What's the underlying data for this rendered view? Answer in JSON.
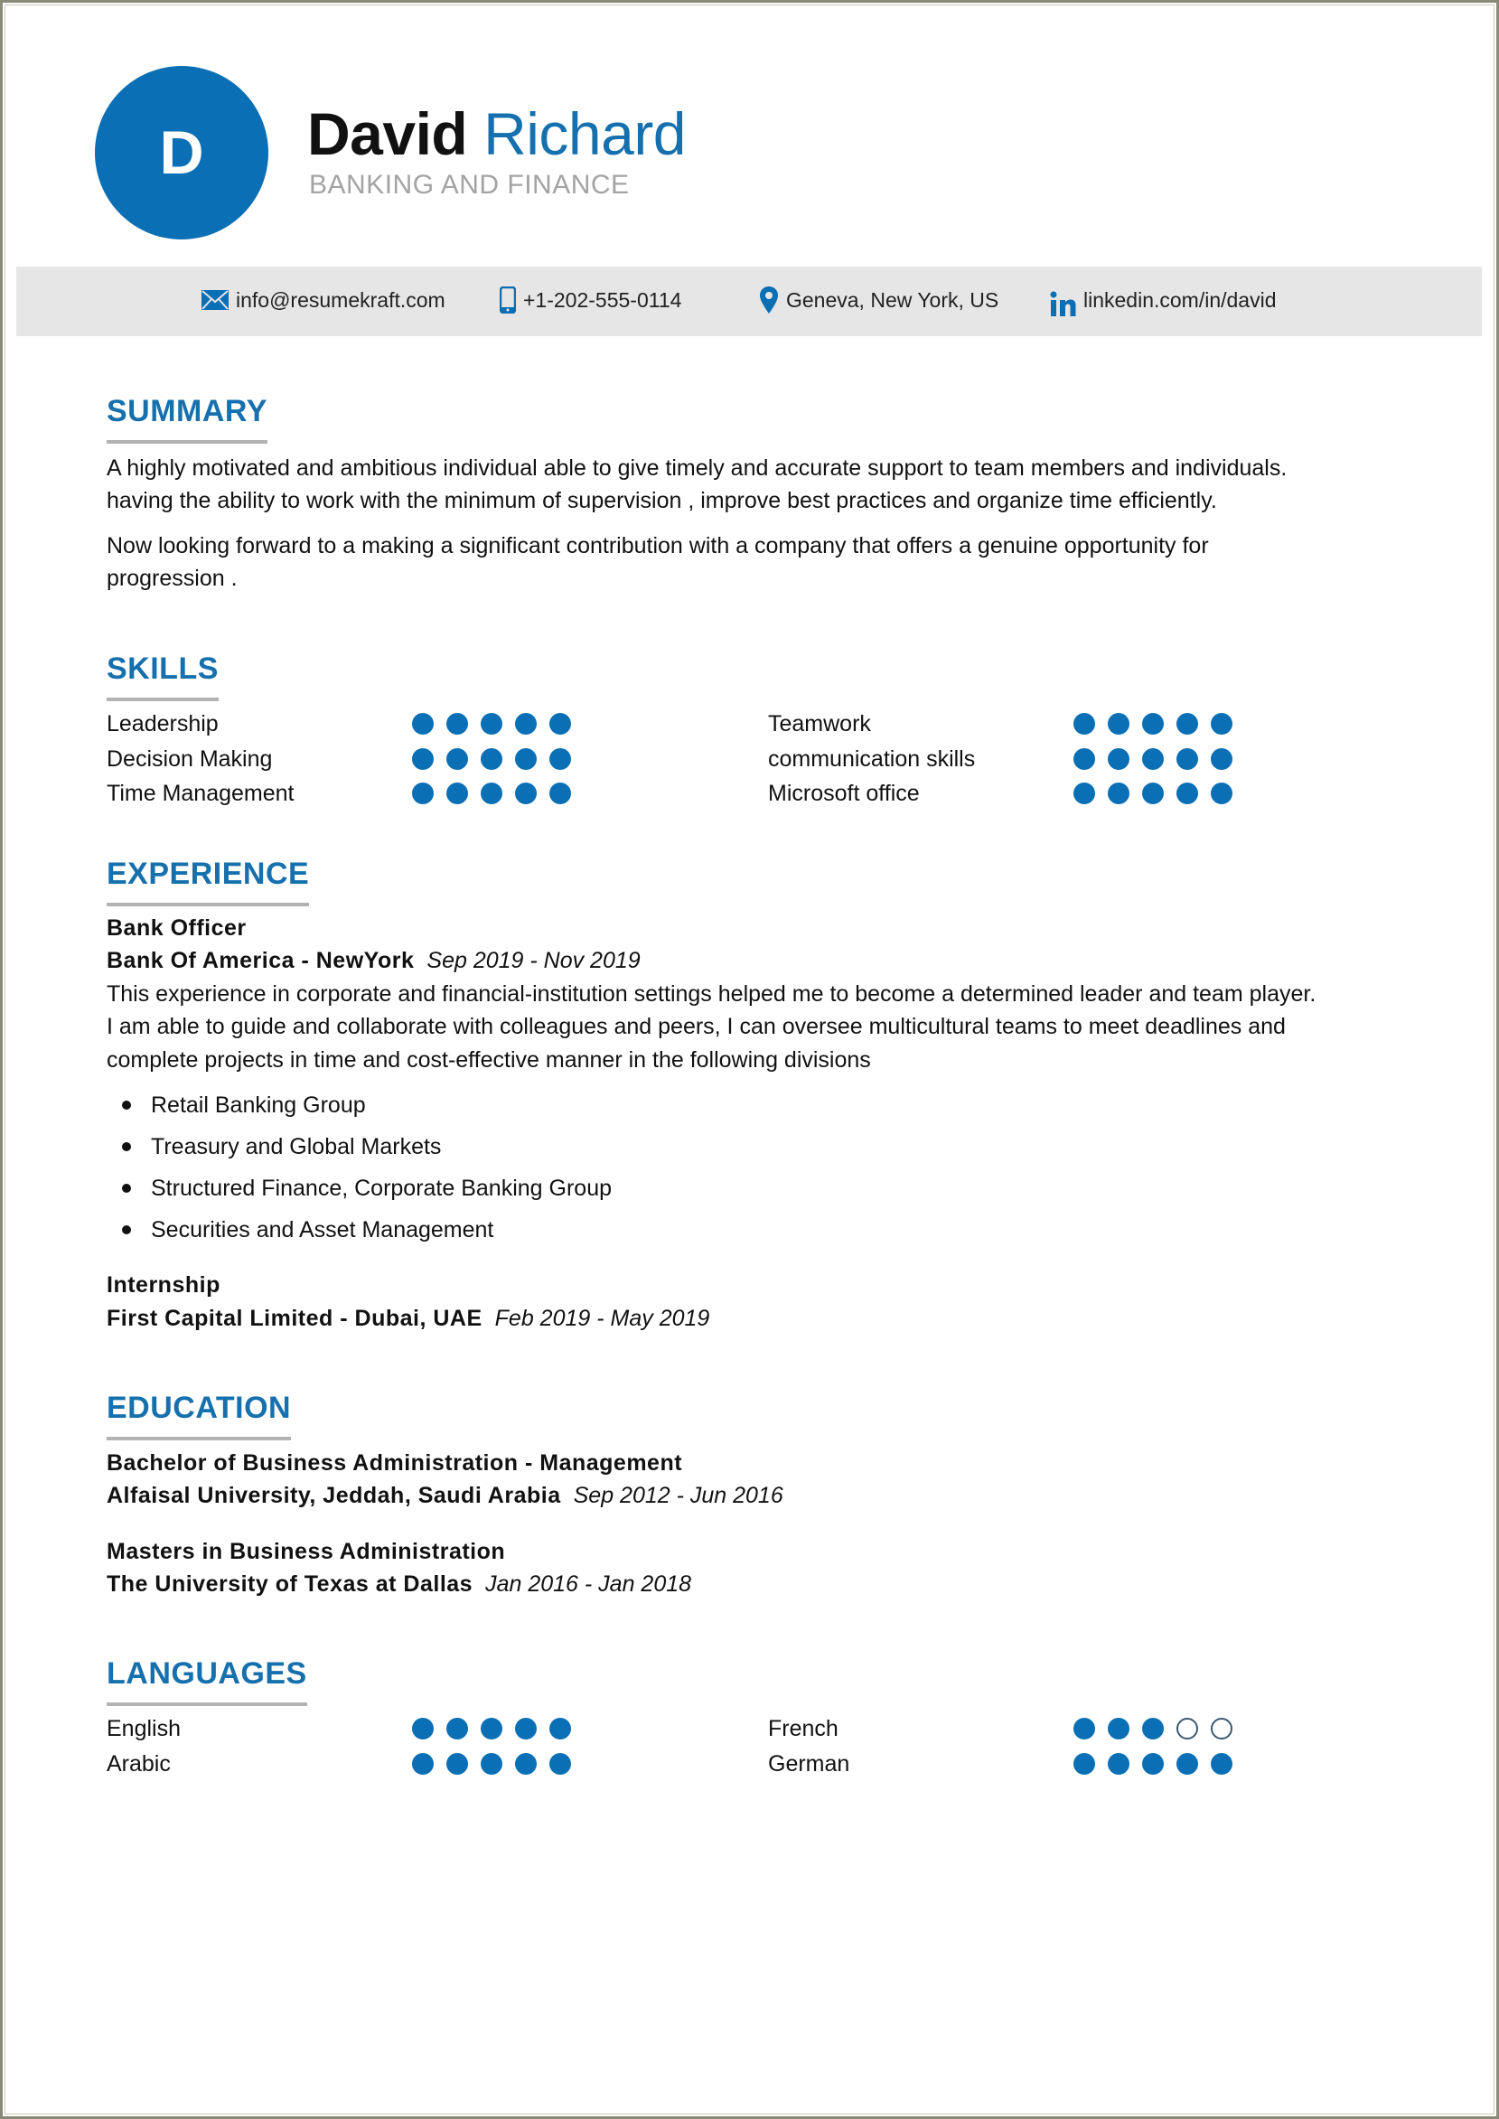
{
  "header": {
    "avatar_initial": "D",
    "first_name": "David",
    "last_name": "Richard",
    "title": "BANKING AND FINANCE"
  },
  "contact": {
    "email": "info@resumekraft.com",
    "phone": "+1-202-555-0114",
    "location": "Geneva, New York, US",
    "linkedin": "linkedin.com/in/david"
  },
  "colors": {
    "accent": "#1570ad",
    "dot_fill": "#0a6fb5",
    "underline": "#b3b3b3",
    "contact_bar": "#e6e6e6",
    "subtitle": "#a3a3a3"
  },
  "summary": {
    "heading": "SUMMARY",
    "paragraphs": [
      [
        "A highly motivated and ambitious individual able to give timely and accurate support to team members and individuals.",
        "having the ability to work with the minimum of supervision , improve best practices and organize time efficiently."
      ],
      [
        "Now looking forward to a making a significant contribution with a company that offers a genuine opportunity for",
        "progression ."
      ]
    ]
  },
  "skills": {
    "heading": "SKILLS",
    "max": 5,
    "items": [
      {
        "name": "Leadership",
        "level": 5
      },
      {
        "name": "Decision Making",
        "level": 5
      },
      {
        "name": "Time Management",
        "level": 5
      },
      {
        "name": "Teamwork",
        "level": 5
      },
      {
        "name": "communication skills",
        "level": 5
      },
      {
        "name": "Microsoft office",
        "level": 5
      }
    ]
  },
  "experience": {
    "heading": "EXPERIENCE",
    "jobs": [
      {
        "title": "Bank Officer",
        "company": "Bank Of America - NewYork",
        "dates": "Sep 2019 - Nov 2019",
        "description": [
          "This experience in corporate and financial-institution settings helped me to become a determined leader and team player.",
          "I am able to guide and collaborate with colleagues and peers, I can oversee multicultural teams to meet deadlines and",
          "complete projects in time and cost-effective manner in the following divisions"
        ],
        "bullets": [
          "Retail Banking Group",
          "Treasury and Global Markets",
          "Structured Finance, Corporate Banking Group",
          "Securities and Asset Management"
        ]
      },
      {
        "title": "Internship",
        "company": "First Capital Limited - Dubai, UAE",
        "dates": "Feb 2019 - May 2019"
      }
    ]
  },
  "education": {
    "heading": "EDUCATION",
    "entries": [
      {
        "degree": "Bachelor of Business Administration - Management",
        "school": "Alfaisal University, Jeddah, Saudi Arabia",
        "dates": "Sep 2012 - Jun 2016"
      },
      {
        "degree": "Masters in Business Administration",
        "school": "The University of Texas at Dallas",
        "dates": "Jan 2016 - Jan 2018"
      }
    ]
  },
  "languages": {
    "heading": "LANGUAGES",
    "max": 5,
    "items": [
      {
        "name": "English",
        "level": 5
      },
      {
        "name": "Arabic",
        "level": 5
      },
      {
        "name": "French",
        "level": 3
      },
      {
        "name": "German",
        "level": 5
      }
    ]
  }
}
